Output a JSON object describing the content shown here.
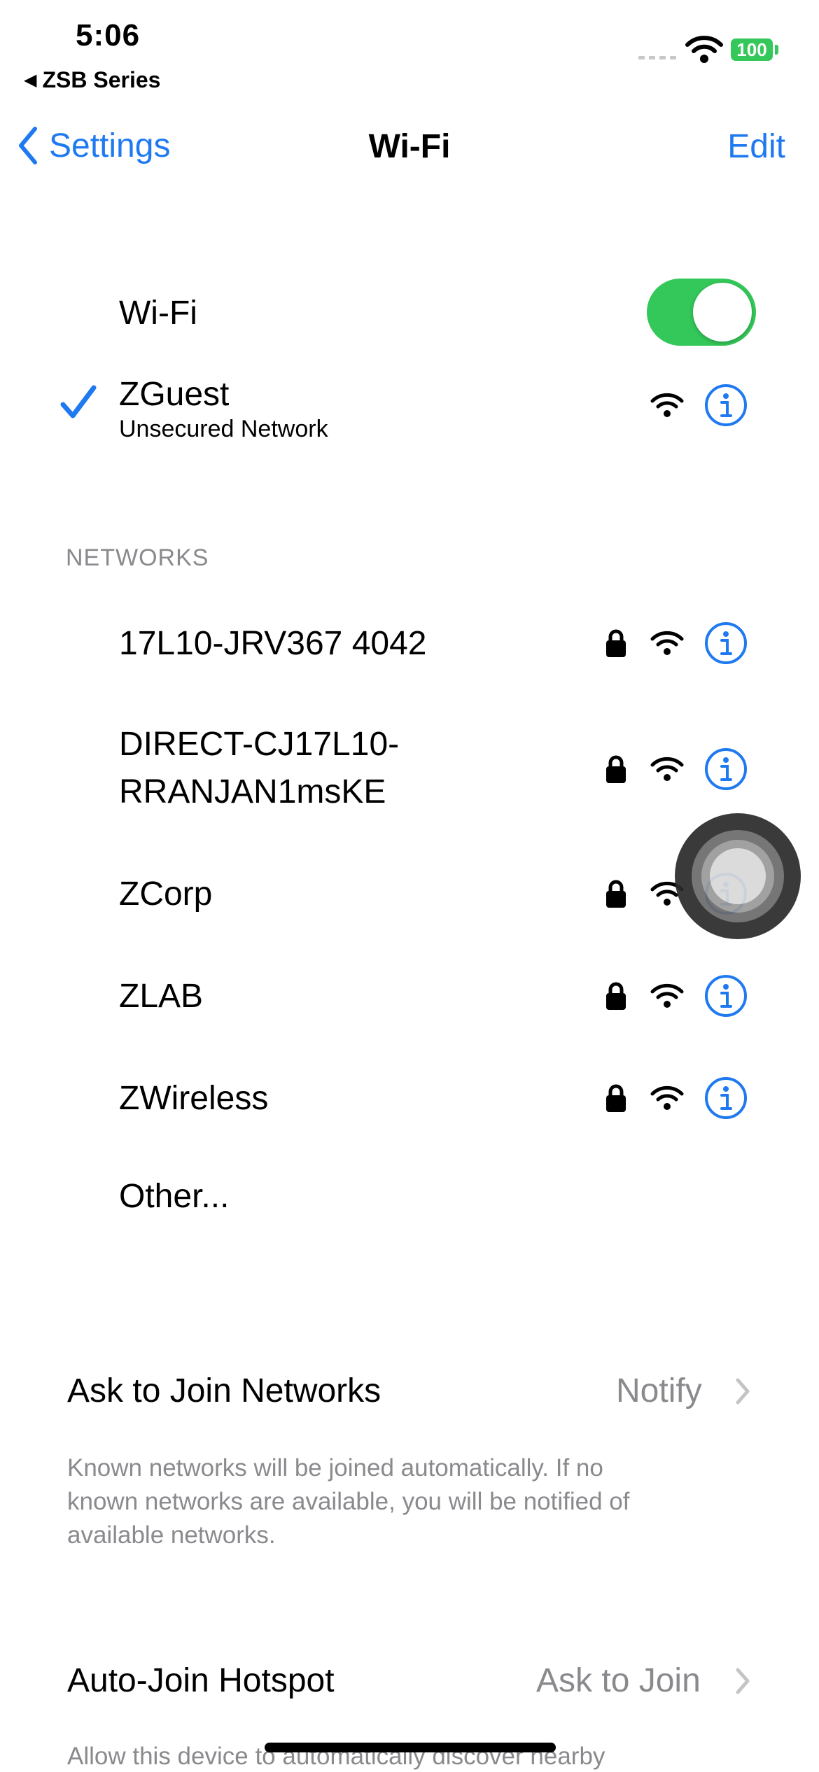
{
  "status_bar": {
    "time": "5:06",
    "back_app": "ZSB Series",
    "battery": "100"
  },
  "nav": {
    "back_label": "Settings",
    "title": "Wi-Fi",
    "edit_label": "Edit"
  },
  "wifi_toggle": {
    "label": "Wi-Fi",
    "on": true
  },
  "connected": {
    "name": "ZGuest",
    "subtitle": "Unsecured Network"
  },
  "networks": {
    "header": "NETWORKS",
    "items": [
      {
        "name": "17L10-JRV367 4042",
        "locked": true
      },
      {
        "name": "DIRECT-CJ17L10-",
        "name_line2": "RRANJAN1msKE",
        "locked": true
      },
      {
        "name": "ZCorp",
        "locked": true
      },
      {
        "name": "ZLAB",
        "locked": true
      },
      {
        "name": "ZWireless",
        "locked": true
      }
    ],
    "other_label": "Other..."
  },
  "ask_to_join": {
    "label": "Ask to Join Networks",
    "value": "Notify",
    "footer_line1": "Known networks will be joined automatically. If no",
    "footer_line2": "known networks are available, you will be notified of",
    "footer_line3": "available networks."
  },
  "auto_join": {
    "label": "Auto-Join Hotspot",
    "value": "Ask to Join",
    "footer_line1": "Allow this device to automatically discover nearby"
  },
  "colors": {
    "accent": "#1f79f0",
    "toggle_on": "#34c759",
    "secondary_text": "#8a8a8e"
  }
}
